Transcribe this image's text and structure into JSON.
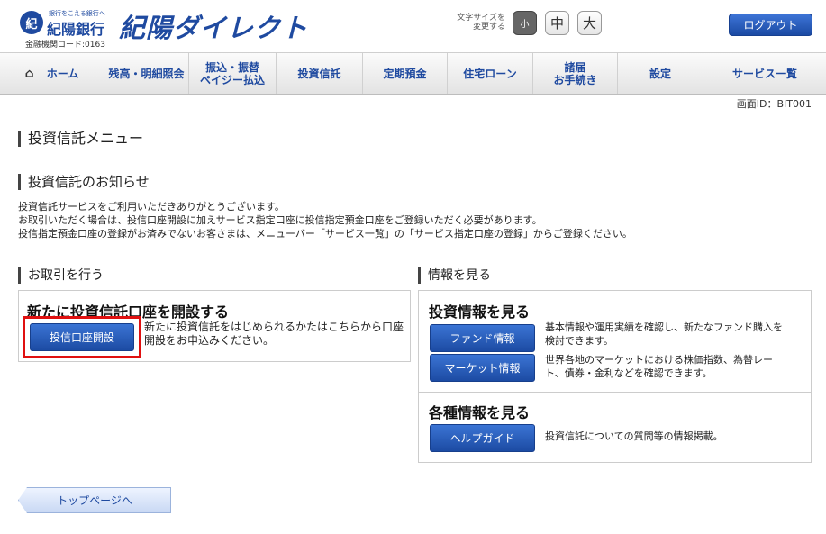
{
  "header": {
    "bank_mark": "紀",
    "bank_slogan": "銀行をこえる銀行へ",
    "bank_name": "紀陽銀行",
    "bank_code": "金融機関コード:0163",
    "service_name": "紀陽ダイレクト",
    "fontsize_label_1": "文字サイズを",
    "fontsize_label_2": "変更する",
    "fs_small": "小",
    "fs_mid": "中",
    "fs_large": "大",
    "logout": "ログアウト"
  },
  "nav": {
    "home": "ホーム",
    "balance": "残高・明細照会",
    "transfer_1": "振込・振替",
    "transfer_2": "ペイジー払込",
    "invest": "投資信託",
    "deposit": "定期預金",
    "loan": "住宅ローン",
    "procedures_1": "諸届",
    "procedures_2": "お手続き",
    "settings": "設定",
    "services": "サービス一覧"
  },
  "screen_id": "画面ID：BIT001",
  "main": {
    "menu_title": "投資信託メニュー",
    "notice_title": "投資信託のお知らせ",
    "notice_line1": "投資信託サービスをご利用いただきありがとうございます。",
    "notice_line2": "お取引いただく場合は、投信口座開設に加えサービス指定口座に投信指定預金口座をご登録いただく必要があります。",
    "notice_line3": "投信指定預金口座の登録がお済みでないお客さまは、メニューバー「サービス一覧」の「サービス指定口座の登録」からご登録ください。",
    "trade_title": "お取引を行う",
    "info_title": "情報を見る",
    "open_title": "新たに投資信託口座を開設する",
    "open_button": "投信口座開設",
    "open_desc": "新たに投資信託をはじめられるかたはこちらから口座開設をお申込みください。",
    "inv_title": "投資情報を見る",
    "fund_button": "ファンド情報",
    "fund_desc": "基本情報や運用実績を確認し、新たなファンド購入を検討できます。",
    "market_button": "マーケット情報",
    "market_desc": "世界各地のマーケットにおける株価指数、為替レート、債券・金利などを確認できます。",
    "other_title": "各種情報を見る",
    "help_button": "ヘルプガイド",
    "help_desc": "投資信託についての質問等の情報掲載。",
    "top_button": "トップページへ"
  },
  "colors": {
    "brand": "#1f4aa0",
    "highlight": "#e01010"
  }
}
